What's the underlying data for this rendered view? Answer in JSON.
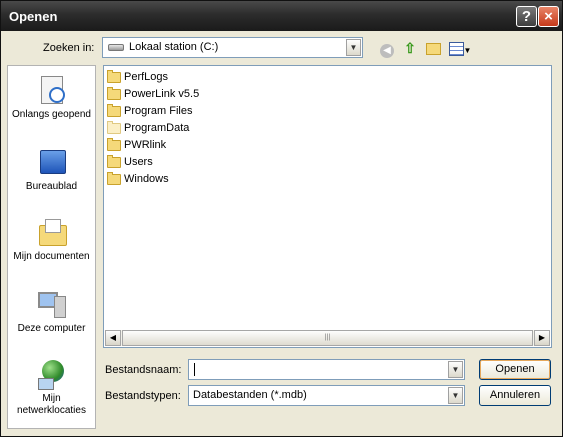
{
  "window": {
    "title": "Openen"
  },
  "titlebar": {
    "help_glyph": "?",
    "close_glyph": "×"
  },
  "lookin": {
    "label": "Zoeken in:",
    "value": "Lokaal station (C:)",
    "icon": "drive-icon"
  },
  "toolbar": {
    "icons": [
      "back-icon",
      "up-folder-icon",
      "new-folder-icon",
      "view-menu-icon"
    ]
  },
  "places": [
    {
      "label": "Onlangs geopend",
      "icon": "recent-icon"
    },
    {
      "label": "Bureaublad",
      "icon": "desktop-icon"
    },
    {
      "label": "Mijn documenten",
      "icon": "my-documents-icon"
    },
    {
      "label": "Deze computer",
      "icon": "my-computer-icon"
    },
    {
      "label": "Mijn netwerklocaties",
      "icon": "network-icon"
    }
  ],
  "files": [
    {
      "name": "PerfLogs",
      "hidden": false
    },
    {
      "name": "PowerLink v5.5",
      "hidden": false
    },
    {
      "name": "Program Files",
      "hidden": false
    },
    {
      "name": "ProgramData",
      "hidden": true
    },
    {
      "name": "PWRlink",
      "hidden": false
    },
    {
      "name": "Users",
      "hidden": false
    },
    {
      "name": "Windows",
      "hidden": false
    }
  ],
  "filename": {
    "label": "Bestandsnaam:",
    "value": ""
  },
  "filetype": {
    "label": "Bestandstypen:",
    "value": "Databestanden (*.mdb)"
  },
  "buttons": {
    "open": "Openen",
    "cancel": "Annuleren"
  },
  "colors": {
    "titlebar": "#2c2c2c",
    "face": "#ece9d8",
    "close": "#c5391a",
    "folder": "#f5d97a"
  }
}
